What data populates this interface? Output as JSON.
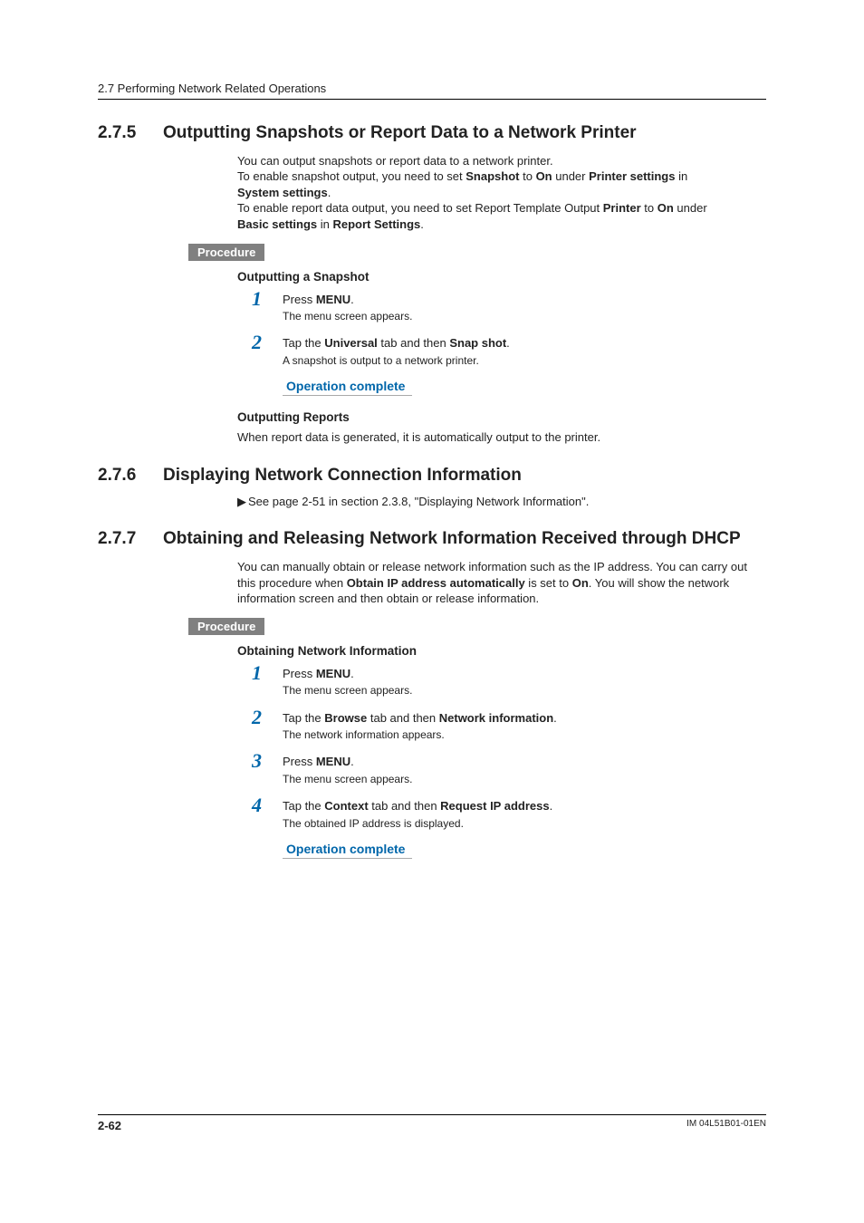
{
  "header": {
    "running_head": "2.7  Performing Network Related Operations"
  },
  "sections": {
    "s275": {
      "num": "2.7.5",
      "title": "Outputting Snapshots or Report Data to a Network Printer",
      "intro_lines": {
        "l1": "You can output snapshots or report data to a network printer.",
        "l2a": "To enable snapshot output, you need to set ",
        "l2b": "Snapshot",
        "l2c": " to ",
        "l2d": "On",
        "l2e": " under ",
        "l2f": "Printer settings",
        "l2g": " in ",
        "l3a": "System settings",
        "l3b": ".",
        "l4a": "To enable report data output, you need to set Report Template Output ",
        "l4b": "Printer",
        "l4c": " to ",
        "l4d": "On",
        "l4e": " under ",
        "l5a": "Basic settings",
        "l5b": " in ",
        "l5c": "Report Settings",
        "l5d": "."
      },
      "procedure_label": "Procedure",
      "sub1_head": "Outputting a Snapshot",
      "steps1": {
        "n1": "1",
        "s1a": "Press ",
        "s1b": "MENU",
        "s1c": ".",
        "r1": "The menu screen appears.",
        "n2": "2",
        "s2a": "Tap the ",
        "s2b": "Universal",
        "s2c": " tab and then ",
        "s2d": "Snap shot",
        "s2e": ".",
        "r2": "A snapshot is output to a network printer."
      },
      "op_complete": "Operation complete",
      "sub2_head": "Outputting Reports",
      "sub2_body": "When report data is generated, it is automatically output to the printer."
    },
    "s276": {
      "num": "2.7.6",
      "title": "Displaying Network Connection Information",
      "see_ref": "See page 2-51 in section 2.3.8, \"Displaying Network Information\"."
    },
    "s277": {
      "num": "2.7.7",
      "title": "Obtaining and Releasing Network Information Received through DHCP",
      "intro": {
        "p1a": "You can manually obtain or release network information such as the IP address. You can carry out this procedure when ",
        "p1b": "Obtain IP address automatically",
        "p1c": " is set to ",
        "p1d": "On",
        "p1e": ". You will show the network information screen and then obtain or release information."
      },
      "procedure_label": "Procedure",
      "sub1_head": "Obtaining Network Information",
      "steps": {
        "n1": "1",
        "s1a": "Press ",
        "s1b": "MENU",
        "s1c": ".",
        "r1": "The menu screen appears.",
        "n2": "2",
        "s2a": "Tap the ",
        "s2b": "Browse",
        "s2c": " tab and then ",
        "s2d": "Network information",
        "s2e": ".",
        "r2": "The network information appears.",
        "n3": "3",
        "s3a": "Press ",
        "s3b": "MENU",
        "s3c": ".",
        "r3": "The menu screen appears.",
        "n4": "4",
        "s4a": "Tap the ",
        "s4b": "Context",
        "s4c": " tab and then ",
        "s4d": "Request IP address",
        "s4e": ".",
        "r4": "The obtained IP address is displayed."
      },
      "op_complete": "Operation complete"
    }
  },
  "footer": {
    "page_num": "2-62",
    "doc_id": "IM 04L51B01-01EN"
  }
}
